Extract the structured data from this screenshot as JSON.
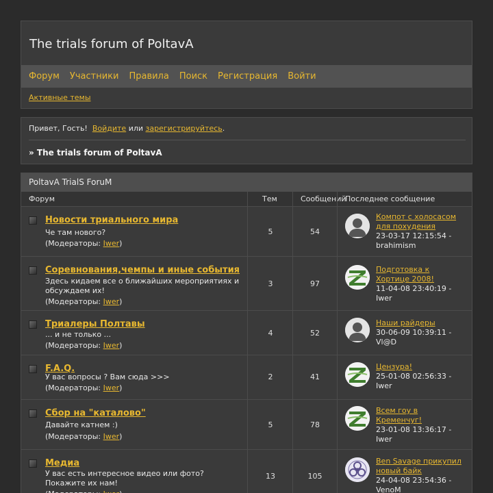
{
  "header": {
    "title": "The trials forum of PoltavA",
    "nav": [
      "Форум",
      "Участники",
      "Правила",
      "Поиск",
      "Регистрация",
      "Войти"
    ],
    "active_topics": "Активные темы"
  },
  "greeting": {
    "hello": "Привет, Гость!",
    "login": "Войдите",
    "or": "или",
    "register": "зарегистрируйтесь",
    "dot": ".",
    "crumb": "» The trials forum of PoltavA"
  },
  "forum": {
    "category": "PoltavA TrialS ForuM",
    "columns": {
      "forum": "Форум",
      "topics": "Тем",
      "posts": "Сообщений",
      "last_post": "Последнее сообщение"
    },
    "mods_prefix": "(Модераторы: ",
    "mods_suffix": ")",
    "rows": [
      {
        "name": "Новости триального мира",
        "desc": "Че там нового?",
        "moderator": "Iwer",
        "topics": "5",
        "posts": "54",
        "avatar": "default-avatar-icon",
        "last_title": "Компот с холосасом для похудения",
        "last_meta": "23-03-17 12:15:54 - brahimism"
      },
      {
        "name": "Соревнования,чемпы и иные события",
        "desc": "Здесь кидаем все о ближайших мероприятиях и обсуждаем их!",
        "moderator": "Iwer",
        "topics": "3",
        "posts": "97",
        "avatar": "z-logo-avatar-icon",
        "last_title": "Подготовка к Хортице 2008!",
        "last_meta": "11-04-08 23:40:19 - Iwer"
      },
      {
        "name": "Триалеры Полтавы",
        "desc": "... и не только ...",
        "moderator": "Iwer",
        "topics": "4",
        "posts": "52",
        "avatar": "default-avatar-icon",
        "last_title": "Наши райдеры",
        "last_meta": "30-06-09 10:39:11 - Vl@D"
      },
      {
        "name": "F.A.Q.",
        "desc": "У вас вопросы ? Вам сюда >>>",
        "moderator": "Iwer",
        "topics": "2",
        "posts": "41",
        "avatar": "z-logo-avatar-icon",
        "last_title": "Цензура!",
        "last_meta": "25-01-08 02:56:33 - Iwer"
      },
      {
        "name": "Сбор на \"каталово\"",
        "desc": "Давайте катнем :)",
        "moderator": "Iwer",
        "topics": "5",
        "posts": "78",
        "avatar": "z-logo-avatar-icon",
        "last_title": "Всем гоу в Кременчуг!",
        "last_meta": "23-01-08 13:36:17 - Iwer"
      },
      {
        "name": "Медиа",
        "desc": "У вас есть интересное видео или фото? Покажите их нам!",
        "moderator": "Iwer",
        "topics": "13",
        "posts": "105",
        "avatar": "biohazard-avatar-icon",
        "last_title": "Ben Savage прикупил новый байк",
        "last_meta": "24-04-08 23:54:36 - VenoM"
      }
    ]
  }
}
